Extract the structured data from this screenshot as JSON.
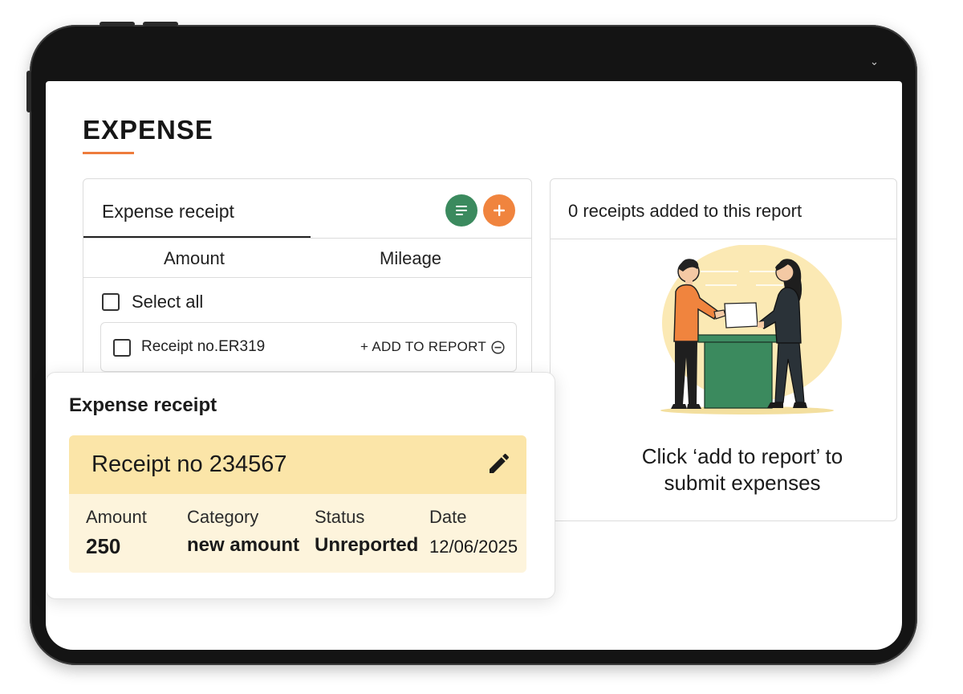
{
  "page": {
    "title": "EXPENSE"
  },
  "left_panel": {
    "title": "Expense receipt",
    "tabs": [
      {
        "label": "Amount"
      },
      {
        "label": "Mileage"
      }
    ],
    "select_all_label": "Select all",
    "receipts": [
      {
        "label": "Receipt no.ER319",
        "add_label": "+ ADD TO REPORT"
      }
    ],
    "icons": {
      "list": "list-icon",
      "add": "plus-icon",
      "remove": "minus-circle-icon"
    }
  },
  "right_panel": {
    "header": "0 receipts added to this report",
    "empty_message_line1": "Click ‘add to report’ to",
    "empty_message_line2": "submit expenses"
  },
  "detail_card": {
    "title": "Expense receipt",
    "receipt_no": "Receipt no 234567",
    "labels": {
      "amount": "Amount",
      "category": "Category",
      "status": "Status",
      "date": "Date"
    },
    "values": {
      "amount": "250",
      "category": "new amount",
      "status": "Unreported",
      "date": "12/06/2025"
    },
    "edit_icon": "pencil-icon"
  },
  "colors": {
    "accent_orange": "#f0843e",
    "accent_green": "#3b8a5e",
    "card_header_bg": "#fbe5a8",
    "card_body_bg": "#fdf4dc"
  }
}
